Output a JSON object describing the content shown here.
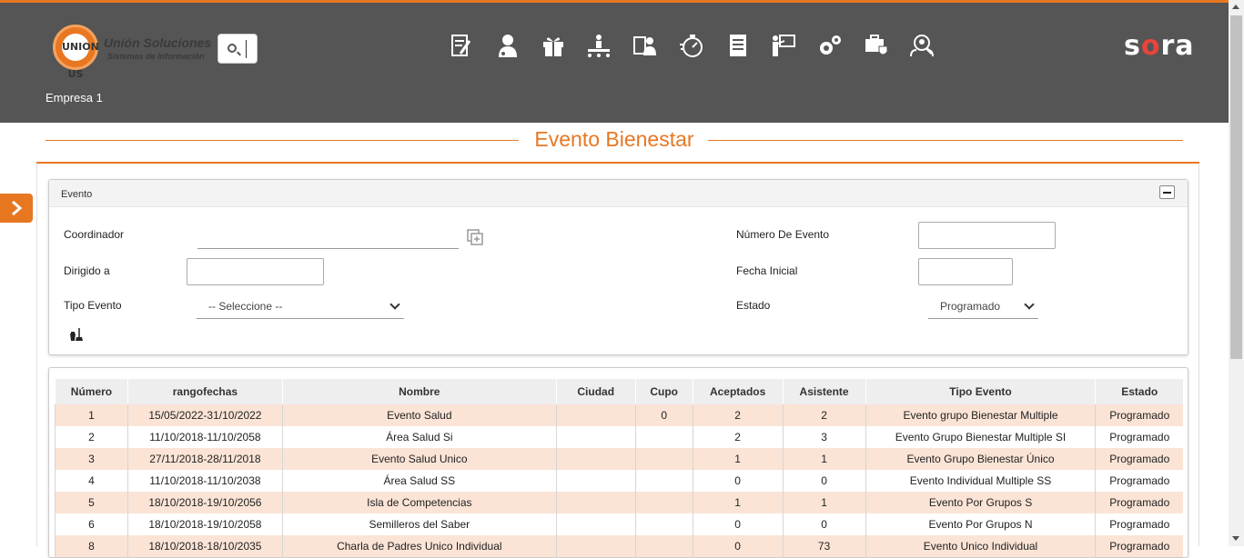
{
  "header": {
    "logo_mark": "UNION US",
    "logo_line1": "Unión Soluciones",
    "logo_line2": "Sistemas de Información",
    "brand": "sora",
    "empresa": "Empresa 1",
    "nav_icons": [
      "document-edit-icon",
      "user-doctor-icon",
      "gift-icon",
      "presenter-icon",
      "id-card-icon",
      "stopwatch-icon",
      "report-icon",
      "teacher-board-icon",
      "gears-icon",
      "medical-kit-icon",
      "search-users-icon"
    ],
    "accent": "#e87722"
  },
  "page": {
    "title": "Evento Bienestar"
  },
  "form": {
    "panel_title": "Evento",
    "coordinador_label": "Coordinador",
    "coordinador_value": "",
    "numero_evento_label": "Número De Evento",
    "numero_evento_value": "",
    "dirigido_label": "Dirigido a",
    "dirigido_value": "",
    "fecha_inicial_label": "Fecha Inicial",
    "fecha_inicial_value": "",
    "tipo_evento_label": "Tipo Evento",
    "tipo_evento_selected": "-- Seleccione --",
    "estado_label": "Estado",
    "estado_selected": "Programado"
  },
  "table": {
    "columns": [
      "Número",
      "rangofechas",
      "Nombre",
      "Ciudad",
      "Cupo",
      "Aceptados",
      "Asistente",
      "Tipo Evento",
      "Estado"
    ],
    "rows": [
      [
        "1",
        "15/05/2022-31/10/2022",
        "Evento Salud",
        "",
        "0",
        "2",
        "2",
        "Evento grupo Bienestar Multiple",
        "Programado"
      ],
      [
        "2",
        "11/10/2018-11/10/2058",
        "Área Salud Si",
        "",
        "",
        "2",
        "3",
        "Evento Grupo Bienestar Multiple SI",
        "Programado"
      ],
      [
        "3",
        "27/11/2018-28/11/2018",
        "Evento Salud Unico",
        "",
        "",
        "1",
        "1",
        "Evento Grupo Bienestar Único",
        "Programado"
      ],
      [
        "4",
        "11/10/2018-11/10/2038",
        "Área Salud SS",
        "",
        "",
        "0",
        "0",
        "Evento Individual Multiple SS",
        "Programado"
      ],
      [
        "5",
        "18/10/2018-19/10/2056",
        "Isla de Competencias",
        "",
        "",
        "1",
        "1",
        "Evento Por Grupos S",
        "Programado"
      ],
      [
        "6",
        "18/10/2018-19/10/2058",
        "Semilleros del Saber",
        "",
        "",
        "0",
        "0",
        "Evento Por Grupos N",
        "Programado"
      ],
      [
        "8",
        "18/10/2018-18/10/2035",
        "Charla de Padres Unico Individual",
        "",
        "",
        "0",
        "73",
        "Evento Unico Individual",
        "Programado"
      ]
    ]
  }
}
